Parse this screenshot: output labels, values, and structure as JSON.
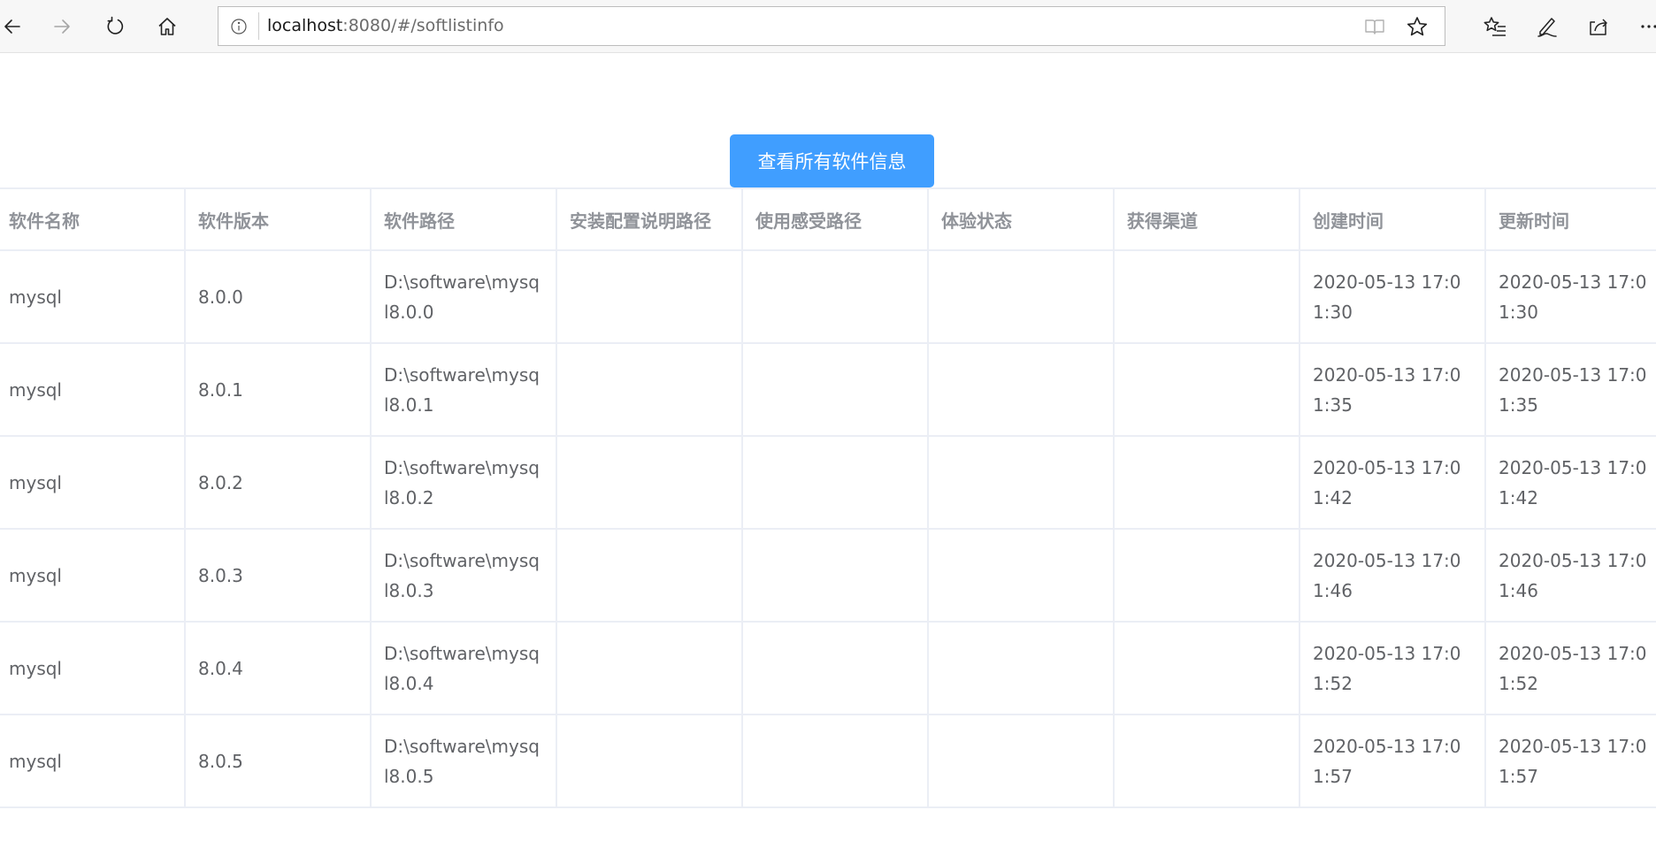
{
  "browser": {
    "url_host": "localhost",
    "url_rest": ":8080/#/softlistinfo"
  },
  "main": {
    "view_button_label": "查看所有软件信息",
    "columns": [
      "软件名称",
      "软件版本",
      "软件路径",
      "安装配置说明路径",
      "使用感受路径",
      "体验状态",
      "获得渠道",
      "创建时间",
      "更新时间"
    ],
    "rows": [
      [
        "mysql",
        "8.0.0",
        "D:\\software\\mysql8.0.0",
        "",
        "",
        "",
        "",
        "2020-05-13 17:01:30",
        "2020-05-13 17:01:30"
      ],
      [
        "mysql",
        "8.0.1",
        "D:\\software\\mysql8.0.1",
        "",
        "",
        "",
        "",
        "2020-05-13 17:01:35",
        "2020-05-13 17:01:35"
      ],
      [
        "mysql",
        "8.0.2",
        "D:\\software\\mysql8.0.2",
        "",
        "",
        "",
        "",
        "2020-05-13 17:01:42",
        "2020-05-13 17:01:42"
      ],
      [
        "mysql",
        "8.0.3",
        "D:\\software\\mysql8.0.3",
        "",
        "",
        "",
        "",
        "2020-05-13 17:01:46",
        "2020-05-13 17:01:46"
      ],
      [
        "mysql",
        "8.0.4",
        "D:\\software\\mysql8.0.4",
        "",
        "",
        "",
        "",
        "2020-05-13 17:01:52",
        "2020-05-13 17:01:52"
      ],
      [
        "mysql",
        "8.0.5",
        "D:\\software\\mysql8.0.5",
        "",
        "",
        "",
        "",
        "2020-05-13 17:01:57",
        "2020-05-13 17:01:57"
      ]
    ]
  },
  "theme": {
    "accent": "#409eff",
    "header_text": "#909399",
    "cell_text": "#606266",
    "border": "#ebeef5"
  }
}
